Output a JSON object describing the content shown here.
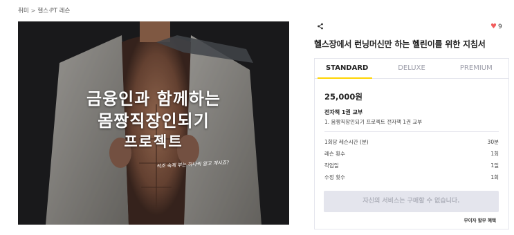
{
  "breadcrumb": {
    "category": "취미",
    "separator": ">",
    "subcategory": "헬스·PT 레슨"
  },
  "hero": {
    "line1": "금융인과 함께하는",
    "line2": "몸짱직장인되기",
    "line3": "프로젝트",
    "subtitle": "석조 숙제 부는 하나씩 알고 계시죠?"
  },
  "actions": {
    "share_icon": "share-icon",
    "like_icon": "heart-icon",
    "like_count": "9",
    "like_color": "#f25c5c"
  },
  "title": "헬스장에서 런닝머신만 하는 헬린이를 위한 지침서",
  "tabs": [
    {
      "label": "STANDARD",
      "active": true
    },
    {
      "label": "DELUXE",
      "active": false
    },
    {
      "label": "PREMIUM",
      "active": false
    }
  ],
  "accent_color": "#ffd400",
  "package": {
    "price": "25,000원",
    "name": "전자책 1권 교부",
    "description": "1. 몸짱직장인되기 프로젝트 전자책 1권 교부",
    "rows": [
      {
        "label": "1회당 레슨시간 (분)",
        "value": "30분"
      },
      {
        "label": "레슨 횟수",
        "value": "1회"
      },
      {
        "label": "작업일",
        "value": "1일"
      },
      {
        "label": "수정 횟수",
        "value": "1회"
      }
    ]
  },
  "buy_button": "자신의 서비스는 구매할 수 없습니다.",
  "installment": "무이자 할부 혜택"
}
